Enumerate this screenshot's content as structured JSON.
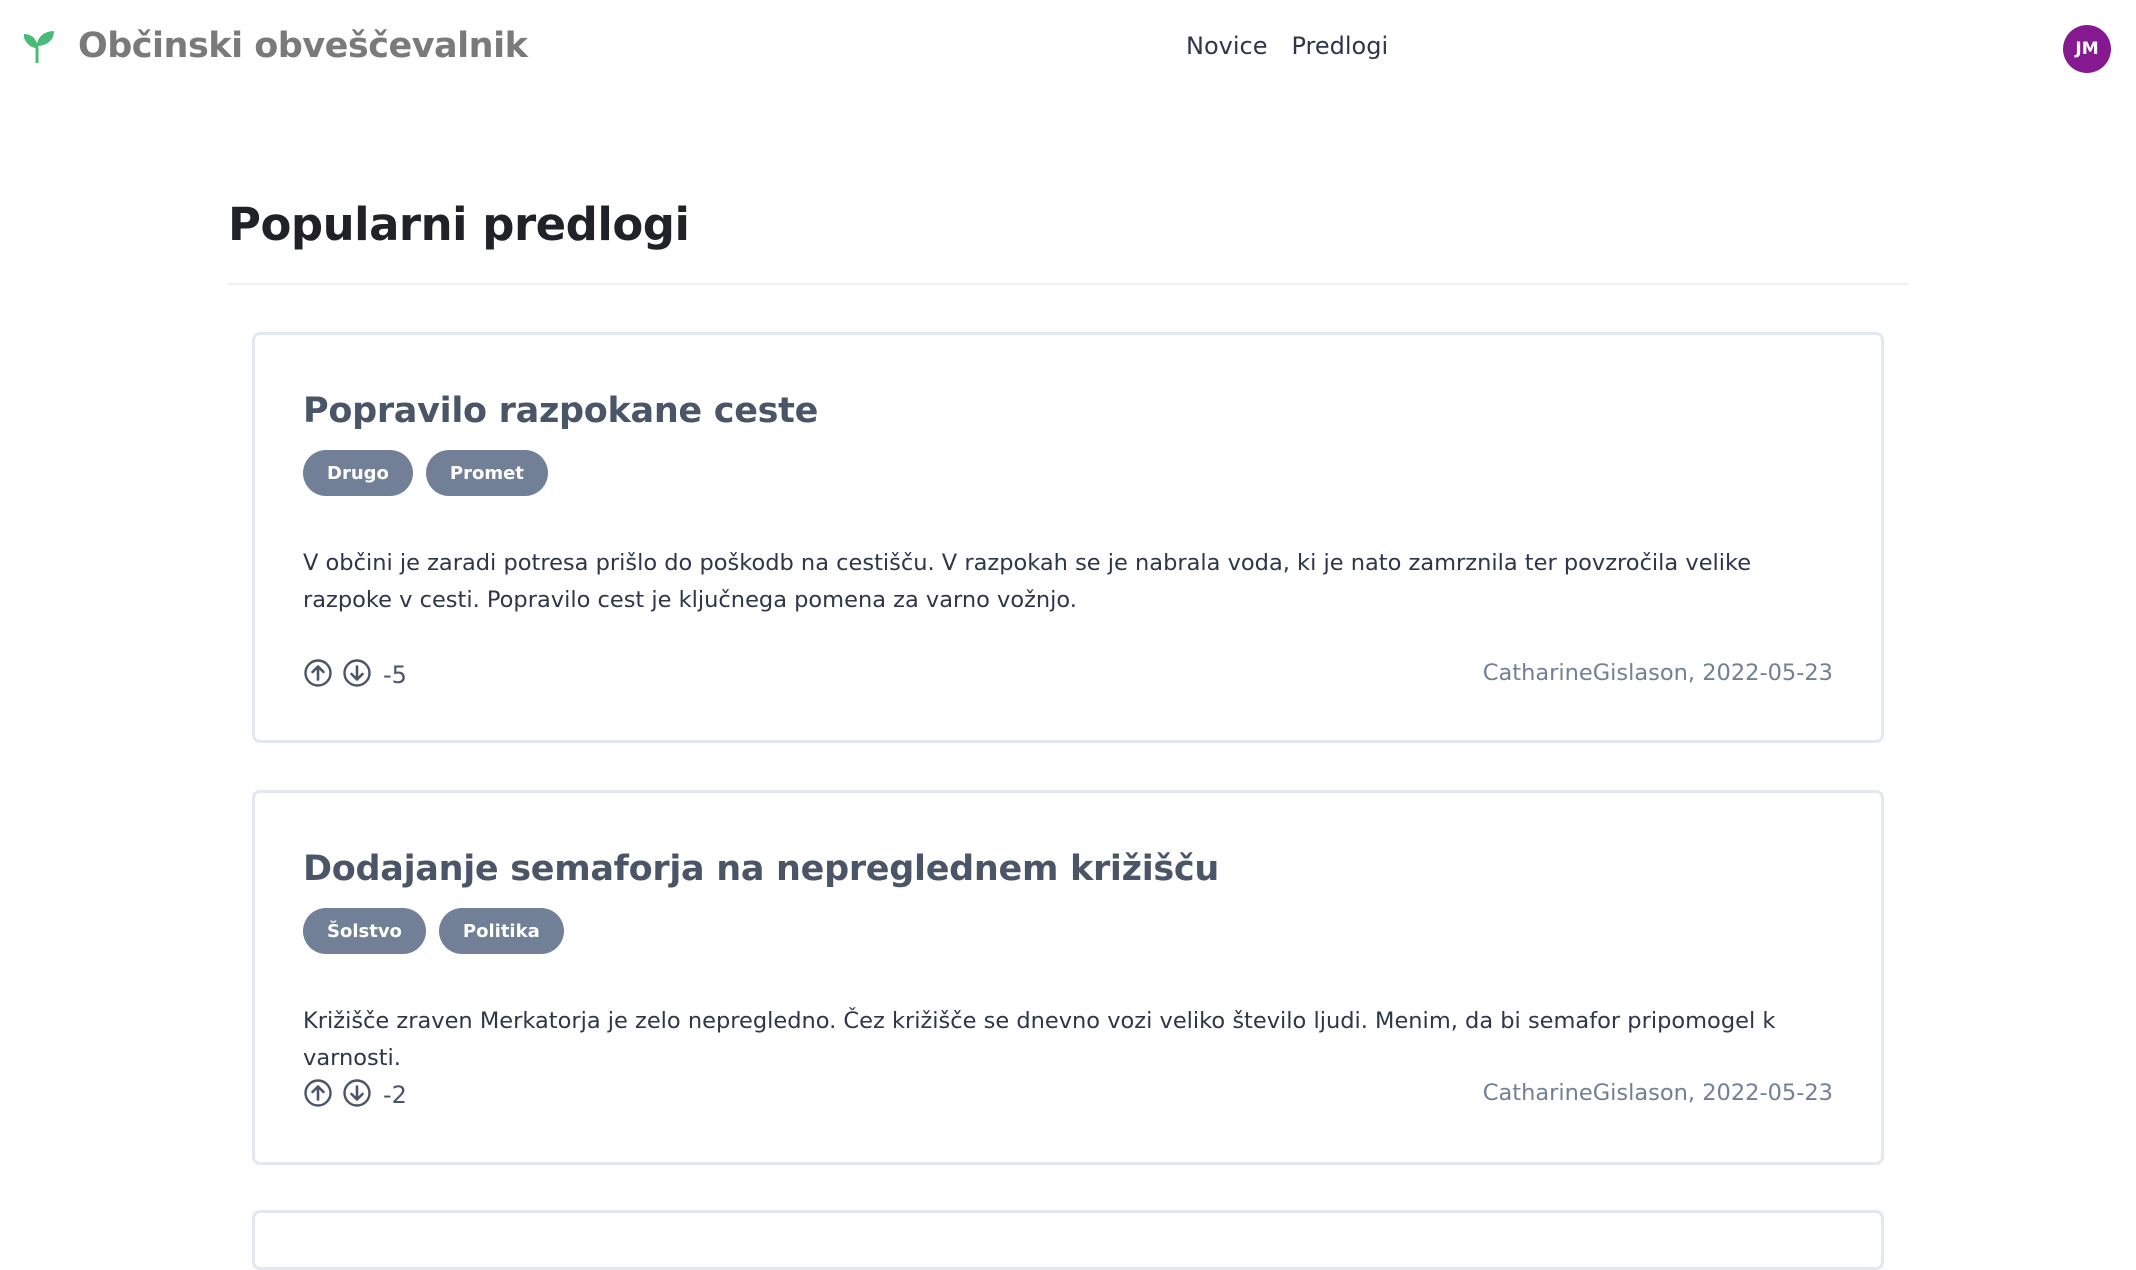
{
  "app": {
    "title": "Občinski obveščevalnik",
    "icon": "seedling-icon",
    "accent_color": "#48bb78"
  },
  "nav": {
    "items": [
      {
        "label": "Novice"
      },
      {
        "label": "Predlogi"
      }
    ]
  },
  "user": {
    "initials": "JM",
    "avatar_color": "#86198f"
  },
  "page": {
    "title": "Popularni predlogi"
  },
  "proposals": [
    {
      "title": "Popravilo razpokane ceste",
      "tags": [
        "Drugo",
        "Promet"
      ],
      "body": "V občini je zaradi potresa prišlo do poškodb na cestišču. V razpokah se je nabrala voda, ki je nato zamrznila ter povzročila velike razpoke v cesti. Popravilo cest je ključnega pomena za varno vožnjo.",
      "score": "-5",
      "meta": "CatharineGislason, 2022-05-23"
    },
    {
      "title": "Dodajanje semaforja na nepreglednem križišču",
      "tags": [
        "Šolstvo",
        "Politika"
      ],
      "body": "Križišče zraven Merkatorja je zelo nepregledno. Čez križišče se dnevno vozi veliko število ljudi. Menim, da bi semafor pripomogel k varnosti.",
      "score": "-2",
      "meta": "CatharineGislason, 2022-05-23"
    }
  ],
  "colors": {
    "tag_bg": "#718096",
    "card_border": "#e2e8f0",
    "title_text": "#4a5568"
  }
}
